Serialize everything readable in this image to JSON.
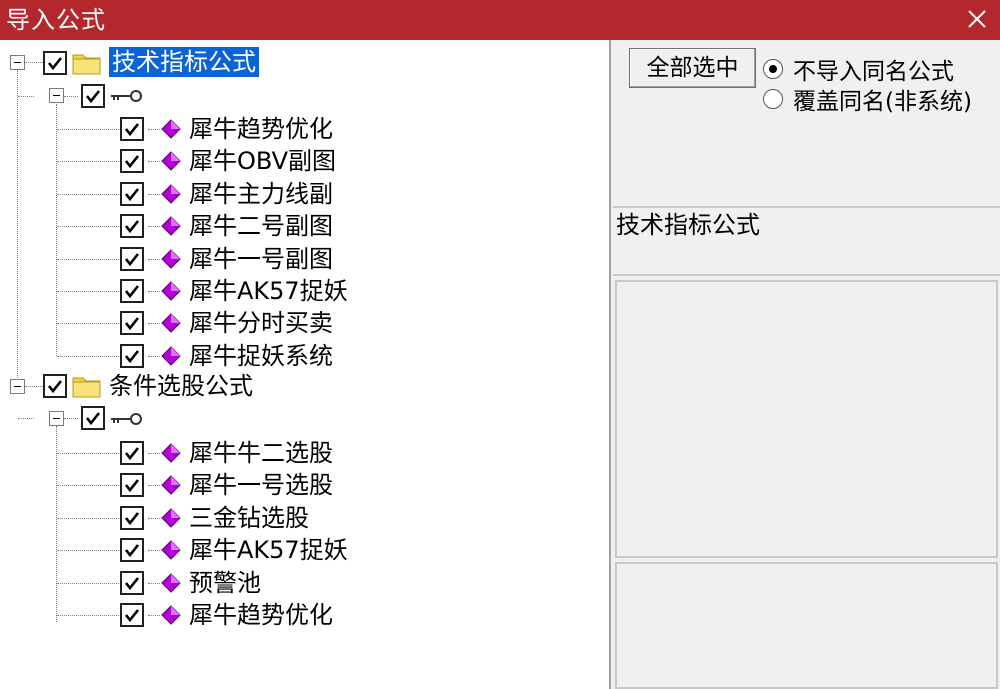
{
  "window": {
    "title": "导入公式"
  },
  "tree": {
    "groups": [
      {
        "label": "技术指标公式",
        "checked": true,
        "subnode_checked": true,
        "items": [
          "犀牛趋势优化",
          "犀牛OBV副图",
          "犀牛主力线副",
          "犀牛二号副图",
          "犀牛一号副图",
          "犀牛AK57捉妖",
          "犀牛分时买卖",
          "犀牛捉妖系统"
        ]
      },
      {
        "label": "条件选股公式",
        "checked": true,
        "subnode_checked": true,
        "items": [
          "犀牛牛二选股",
          "犀牛一号选股",
          "三金钻选股",
          "犀牛AK57捉妖",
          "预警池",
          "犀牛趋势优化"
        ]
      }
    ]
  },
  "right": {
    "select_all_label": "全部选中",
    "radio_no_import": "不导入同名公式",
    "radio_overwrite": "覆盖同名(非系统)",
    "radio_selected": "no_import",
    "info_text": "技术指标公式"
  },
  "colors": {
    "titlebar": "#b2282c",
    "selection": "#0a64d8",
    "gem": "#b400d8",
    "folder": "#f2d340"
  }
}
